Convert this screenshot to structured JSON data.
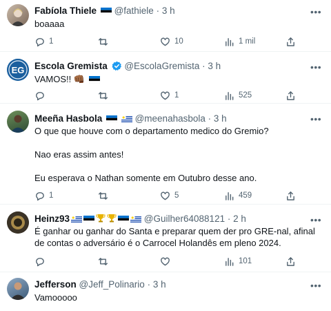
{
  "tweets": [
    {
      "name": "Fabíola Thiele",
      "handle": "@fathiele",
      "time": "3 h",
      "text": [
        "boaaaa"
      ],
      "replies": "1",
      "retweets": "",
      "likes": "10",
      "views": "1 mil",
      "flags": [
        "estonia-flag"
      ]
    },
    {
      "name": "Escola Gremista",
      "handle": "@EscolaGremista",
      "time": "3 h",
      "text": [
        "VAMOS!! 👊🏾"
      ],
      "replies": "",
      "retweets": "",
      "likes": "1",
      "views": "525",
      "flags": [
        "estonia-flag"
      ],
      "avatar_initials": "EG",
      "verified": true
    },
    {
      "name": "Meeña Hasbola",
      "handle": "@meenahasbola",
      "time": "3 h",
      "text": [
        "O que que houve com o departamento medico do Gremio?",
        "Nao eras assim antes!",
        "Eu esperava o Nathan somente em Outubro desse ano."
      ],
      "replies": "1",
      "retweets": "",
      "likes": "5",
      "views": "459",
      "flags": [
        "estonia-flag",
        "uruguay-flag"
      ]
    },
    {
      "name": "Heinz93",
      "handle": "@Guilher64088121",
      "time": "2 h",
      "text": [
        "É ganhar ou ganhar do Santa e preparar quem der pro GRE-nal, afinal de contas o adversário é o Carrocel Holandês em pleno 2024."
      ],
      "replies": "",
      "retweets": "",
      "likes": "",
      "views": "101",
      "flags": [
        "uruguay-flag",
        "estonia-flag",
        "trophy-icon",
        "trophy-icon",
        "estonia-flag",
        "uruguay-flag"
      ]
    },
    {
      "name": "Jefferson",
      "handle": "@Jeff_Polinario",
      "time": "3 h",
      "text": [
        "Vamooooo"
      ],
      "replies": "",
      "retweets": "",
      "likes": "",
      "views": "",
      "flags": []
    }
  ],
  "separator": "·",
  "more_glyph": "•••",
  "colors": {
    "text": "#0f1419",
    "muted": "#536471",
    "divider": "#eff3f4",
    "verified": "#1d9bf0",
    "estonia_blue": "#0072ce"
  }
}
